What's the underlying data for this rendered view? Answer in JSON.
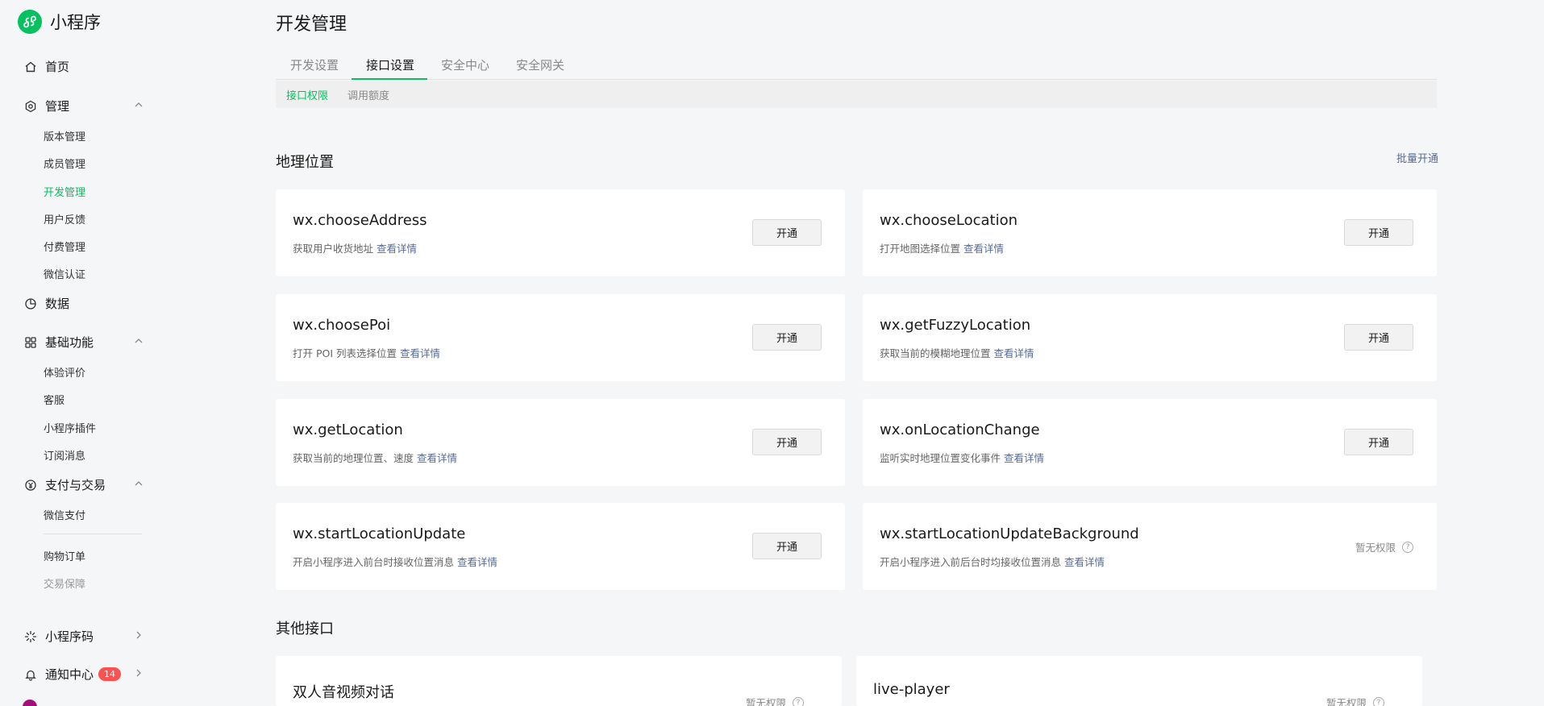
{
  "brand": {
    "name": "小程序"
  },
  "sidebar": {
    "home": "首页",
    "manage": {
      "label": "管理",
      "items": [
        "版本管理",
        "成员管理",
        "开发管理",
        "用户反馈",
        "付费管理",
        "微信认证"
      ]
    },
    "data": "数据",
    "basic": {
      "label": "基础功能",
      "items": [
        "体验评价",
        "客服",
        "小程序插件",
        "订阅消息"
      ]
    },
    "pay": {
      "label": "支付与交易",
      "items": [
        "微信支付",
        "购物订单",
        "交易保障"
      ]
    },
    "qrcode": "小程序码",
    "notify": {
      "label": "通知中心",
      "badge": "14"
    }
  },
  "page": {
    "title": "开发管理"
  },
  "tabs": [
    "开发设置",
    "接口设置",
    "安全中心",
    "安全网关"
  ],
  "subtabs": [
    "接口权限",
    "调用额度"
  ],
  "geo": {
    "title": "地理位置",
    "batch": "批量开通",
    "cards": [
      {
        "name": "wx.chooseAddress",
        "desc": "获取用户收货地址",
        "link": "查看详情",
        "action": "开通"
      },
      {
        "name": "wx.chooseLocation",
        "desc": "打开地图选择位置",
        "link": "查看详情",
        "action": "开通"
      },
      {
        "name": "wx.choosePoi",
        "desc": "打开 POI 列表选择位置",
        "link": "查看详情",
        "action": "开通"
      },
      {
        "name": "wx.getFuzzyLocation",
        "desc": "获取当前的模糊地理位置",
        "link": "查看详情",
        "action": "开通"
      },
      {
        "name": "wx.getLocation",
        "desc": "获取当前的地理位置、速度",
        "link": "查看详情",
        "action": "开通"
      },
      {
        "name": "wx.onLocationChange",
        "desc": "监听实时地理位置变化事件",
        "link": "查看详情",
        "action": "开通"
      },
      {
        "name": "wx.startLocationUpdate",
        "desc": "开启小程序进入前台时接收位置消息",
        "link": "查看详情",
        "action": "开通"
      },
      {
        "name": "wx.startLocationUpdateBackground",
        "desc": "开启小程序进入前后台时均接收位置消息",
        "link": "查看详情",
        "status": "暂无权限"
      }
    ]
  },
  "other": {
    "title": "其他接口",
    "cards": [
      {
        "name": "双人音视频对话",
        "status": "暂无权限"
      },
      {
        "name": "live-player",
        "status": "暂无权限"
      }
    ]
  },
  "colors": {
    "accent": "#07c160",
    "link": "#576b95",
    "badge": "#fa5151"
  }
}
